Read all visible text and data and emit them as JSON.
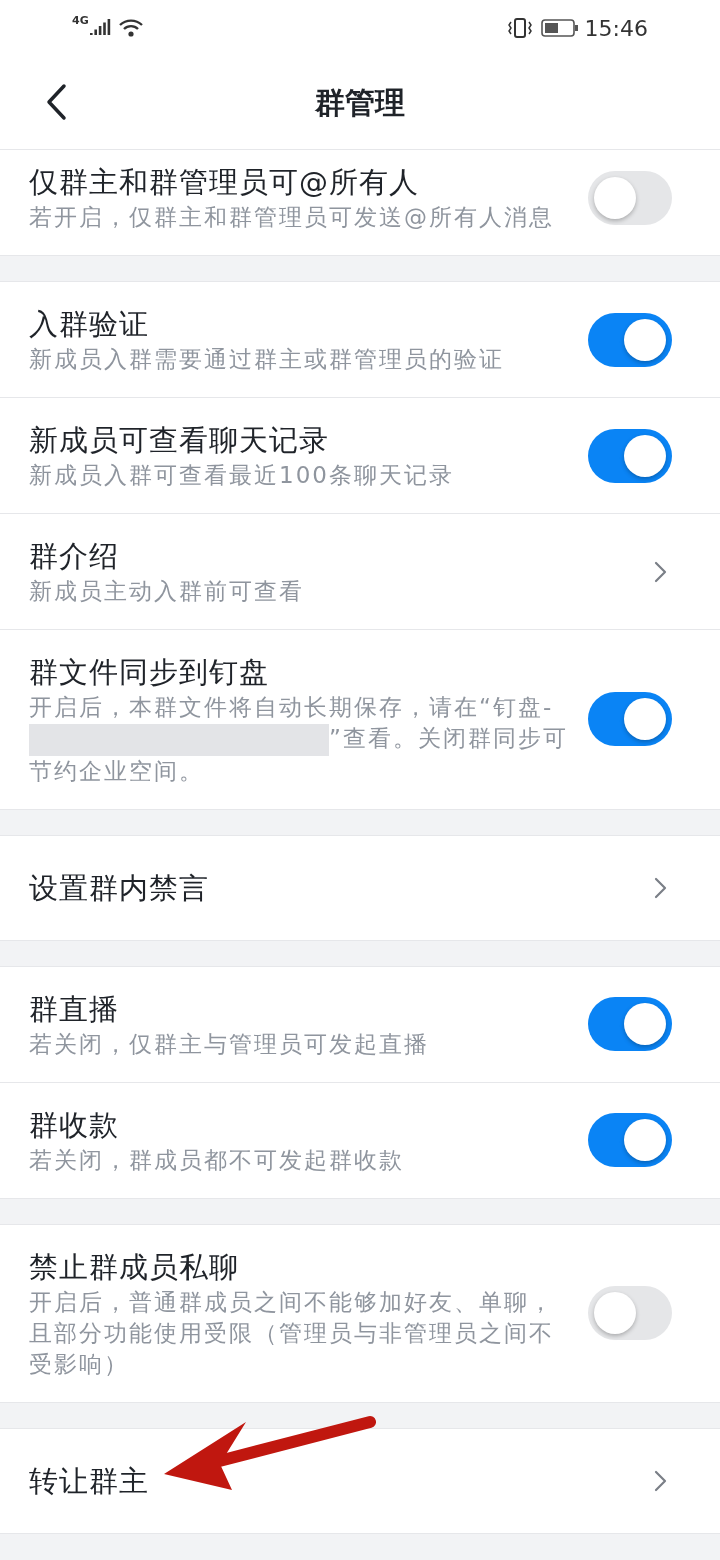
{
  "status_bar": {
    "network": "4G",
    "time": "15:46"
  },
  "header": {
    "title": "群管理"
  },
  "sections": [
    {
      "items": [
        {
          "kind": "toggle",
          "title": "仅群主和群管理员可@所有人",
          "subtitle": "若开启，仅群主和群管理员可发送@所有人消息",
          "on": false
        }
      ]
    },
    {
      "items": [
        {
          "kind": "toggle",
          "title": "入群验证",
          "subtitle": "新成员入群需要通过群主或群管理员的验证",
          "on": true
        },
        {
          "kind": "toggle",
          "title": "新成员可查看聊天记录",
          "subtitle": "新成员入群可查看最近100条聊天记录",
          "on": true
        },
        {
          "kind": "link",
          "title": "群介绍",
          "subtitle": "新成员主动入群前可查看"
        },
        {
          "kind": "toggle",
          "title": "群文件同步到钉盘",
          "subtitle": "开启后，本群文件将自动长期保存，请在“钉盘-",
          "redacted": true,
          "subtitle_after": "”查看。关闭群同步可节约企业空间。",
          "on": true
        }
      ]
    },
    {
      "items": [
        {
          "kind": "link",
          "title": "设置群内禁言"
        }
      ]
    },
    {
      "items": [
        {
          "kind": "toggle",
          "title": "群直播",
          "subtitle": "若关闭，仅群主与管理员可发起直播",
          "on": true
        },
        {
          "kind": "toggle",
          "title": "群收款",
          "subtitle": "若关闭，群成员都不可发起群收款",
          "on": true
        }
      ]
    },
    {
      "items": [
        {
          "kind": "toggle",
          "title": "禁止群成员私聊",
          "subtitle": "开启后，普通群成员之间不能够加好友、单聊，且部分功能使用受限（管理员与非管理员之间不受影响）",
          "on": false
        }
      ]
    },
    {
      "items": [
        {
          "kind": "link",
          "title": "转让群主"
        }
      ]
    }
  ]
}
